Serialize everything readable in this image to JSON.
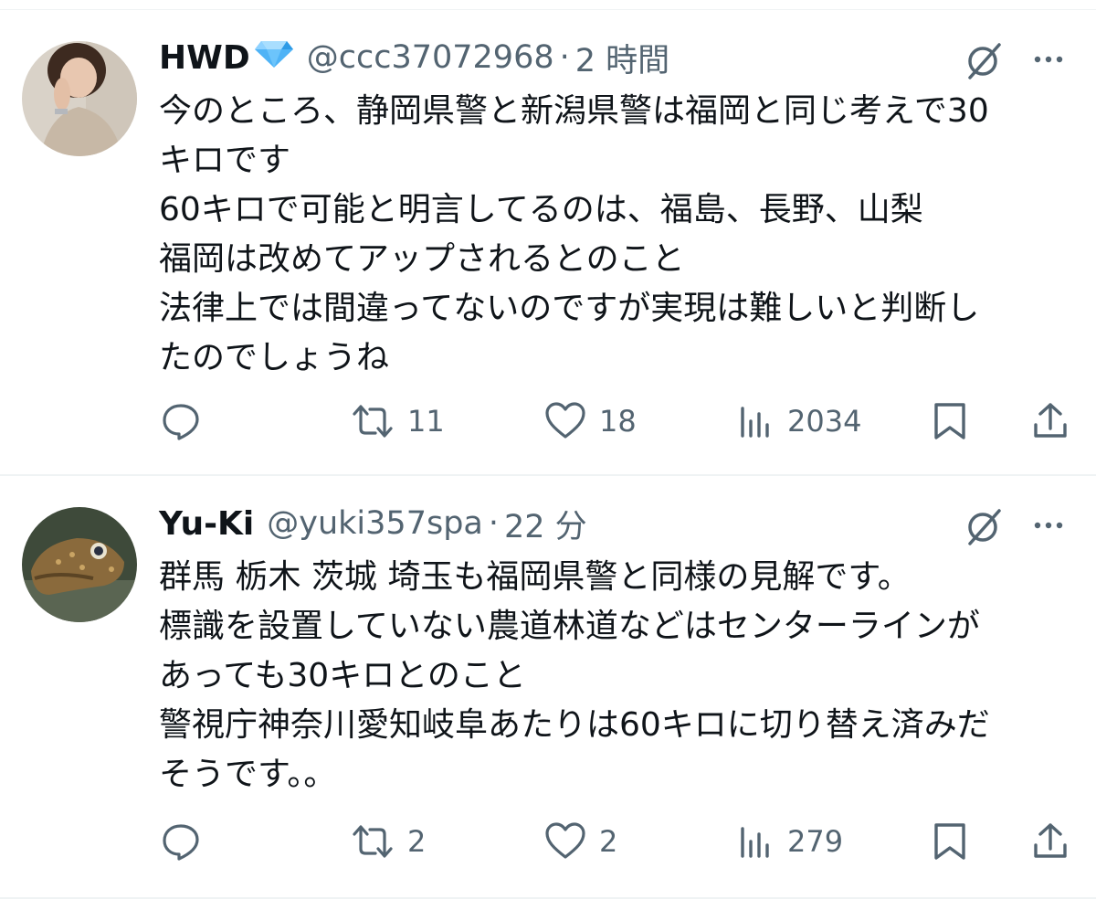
{
  "tweets": [
    {
      "display_name": "HWD",
      "badge_icon": "diamond-icon",
      "handle": "@ccc37072968",
      "separator": "·",
      "time": "2 時間",
      "lines": [
        "今のところ、静岡県警と新潟県警は福岡と同じ考えで30",
        "キロです",
        "60キロで可能と明言してるのは、福島、長野、山梨",
        "福岡は改めてアップされるとのこと",
        "法律上では間違ってないのですが実現は難しいと判断し",
        "たのでしょうね"
      ],
      "retweets": "11",
      "likes": "18",
      "views": "2034"
    },
    {
      "display_name": "Yu-Ki",
      "handle": "@yuki357spa",
      "separator": "·",
      "time": "22 分",
      "lines": [
        "群馬 栃木 茨城 埼玉も福岡県警と同様の見解です。",
        "標識を設置していない農道林道などはセンターラインが",
        "あっても30キロとのこと",
        "警視庁神奈川愛知岐阜あたりは60キロに切り替え済みだ",
        "そうです。。"
      ],
      "retweets": "2",
      "likes": "2",
      "views": "279"
    }
  ],
  "colors": {
    "text_primary": "#0f1419",
    "text_secondary": "#536471",
    "divider": "#eff3f4",
    "diamond": "#4fb3f6"
  }
}
